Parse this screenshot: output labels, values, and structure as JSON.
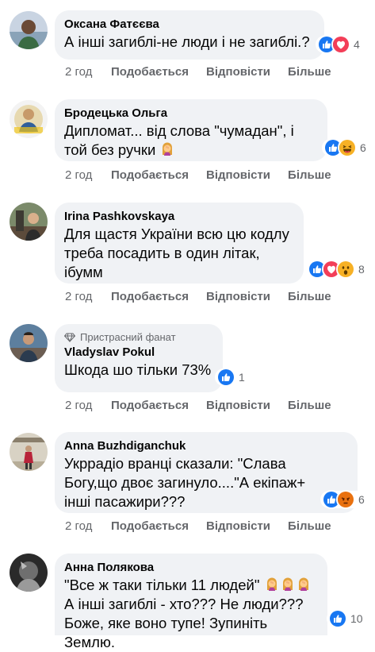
{
  "colors": {
    "like": "#1877f2",
    "love": "#f33e58",
    "haha": "#f7b125",
    "angry": "#e9710f",
    "bubble": "#f0f2f5",
    "muted": "#65676b"
  },
  "actions": {
    "reply_like": "Подобається",
    "reply": "Відповісти",
    "more": "Більше"
  },
  "comments": [
    {
      "author": "Оксана Фатєєва",
      "text": [
        "А інші загиблі-не люди і не загиблі.?"
      ],
      "time": "2 год",
      "reactions": [
        "like-icon",
        "love-icon"
      ],
      "count": "4"
    },
    {
      "author": "Бродецька Ольга",
      "text": [
        "Дипломат... від слова \"чумадан\", і",
        "той без ручки"
      ],
      "time": "2 год",
      "reactions": [
        "like-icon",
        "haha-icon"
      ],
      "count": "6"
    },
    {
      "author": "Irina Pashkovskaya",
      "text": [
        "Для щастя України всю цю кодлу",
        "треба посадить в один літак,",
        "ібумм"
      ],
      "time": "2 год",
      "reactions": [
        "like-icon",
        "love-icon",
        "wow-icon"
      ],
      "count": "8"
    },
    {
      "badge": "Пристрасний фанат",
      "author": "Vladyslav Pokul",
      "text": [
        "Шкода шо тільки 73%"
      ],
      "time": "2 год",
      "reactions": [
        "like-icon"
      ],
      "count": "1"
    },
    {
      "author": "Anna Buzhdiganchuk",
      "text": [
        "Укррадіо вранці сказали: \"Слава",
        "Богу,що двоє загинуло....\"А екіпаж+",
        "інші пасажири???"
      ],
      "time": "2 год",
      "reactions": [
        "like-icon",
        "angry-icon"
      ],
      "count": "6"
    },
    {
      "author": "Анна Полякова",
      "text": [
        "\"Все ж таки тільки 11 людей\"",
        "А інші загиблі - хто??? Не люди???",
        "Боже, яке воно тупе! Зупиніть Землю."
      ],
      "time": "",
      "reactions": [
        "like-icon"
      ],
      "count": "10"
    }
  ]
}
